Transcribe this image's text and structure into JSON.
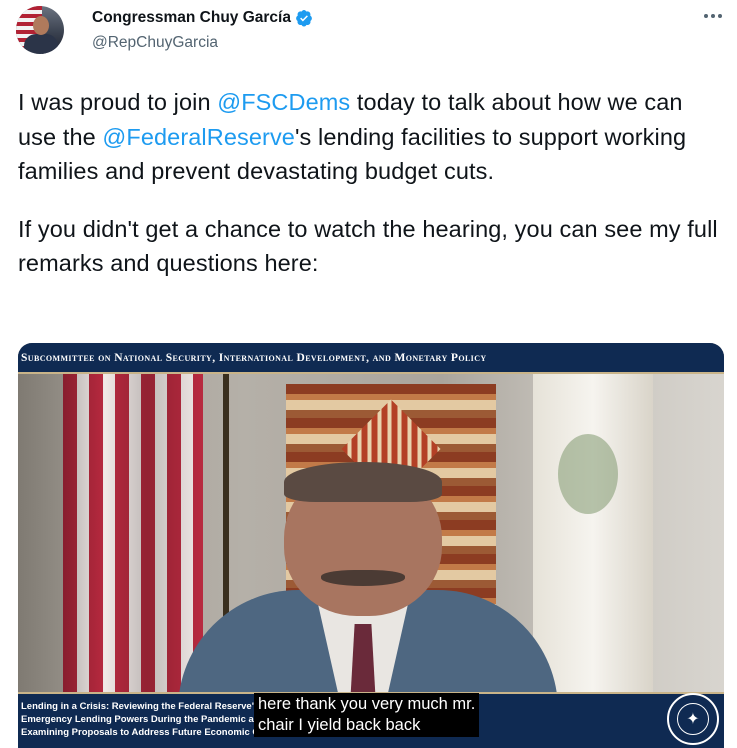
{
  "author": {
    "name": "Congressman Chuy García",
    "handle": "@RepChuyGarcia",
    "verified_icon": "verified-badge-icon"
  },
  "tweet": {
    "p1_a": "I was proud to join ",
    "p1_mention1": "@FSCDems",
    "p1_b": " today to talk about how we can use the ",
    "p1_mention2": "@FederalReserve",
    "p1_c": "'s lending facilities to support working families and prevent devastating budget cuts.",
    "p2": "If you didn't get a chance to watch the hearing, you can see my full remarks and questions here:"
  },
  "media": {
    "banner": "Subcommittee on National Security, International Development, and Monetary Policy",
    "lower_title": "Lending in a Crisis: Reviewing the Federal Reserve's\nEmergency Lending Powers During the Pandemic and\nExamining Proposals to Address Future Economic Crises",
    "caption": "here thank you very much mr.\nchair I yield back back",
    "seal_icon": "house-financial-services-seal-icon"
  },
  "colors": {
    "mention": "#1d9bf0",
    "verified": "#1d9bf0",
    "banner_bg": "#0f2a52"
  }
}
